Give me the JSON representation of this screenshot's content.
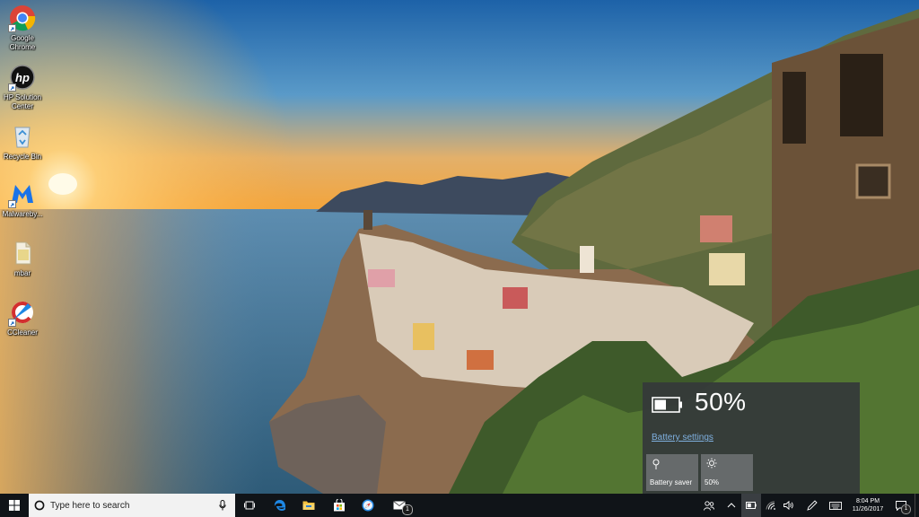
{
  "desktop": {
    "icons": [
      {
        "label": "Google Chrome",
        "icon": "chrome-icon"
      },
      {
        "label": "HP Solution Center",
        "icon": "hp-icon"
      },
      {
        "label": "Recycle Bin",
        "icon": "recycle-bin-icon"
      },
      {
        "label": "Malwareby...",
        "icon": "malwarebytes-icon"
      },
      {
        "label": "mbar",
        "icon": "file-icon"
      },
      {
        "label": "CCleaner",
        "icon": "ccleaner-icon"
      }
    ]
  },
  "battery_flyout": {
    "percent_text": "50%",
    "level": 0.5,
    "settings_link": "Battery settings",
    "tiles": [
      {
        "label": "Battery saver",
        "icon": "battery-saver-icon"
      },
      {
        "label": "50%",
        "icon": "brightness-icon"
      }
    ]
  },
  "taskbar": {
    "search_placeholder": "Type here to search",
    "pinned": [
      "task-view-icon",
      "edge-icon",
      "file-explorer-icon",
      "store-icon",
      "safari-icon",
      "mail-icon"
    ],
    "mail_badge": "1",
    "clock": {
      "time": "8:04 PM",
      "date": "11/26/2017"
    },
    "notification_badge": "1"
  },
  "colors": {
    "taskbar": "#101418",
    "flyout": "#34383a",
    "link": "#7fb0e0",
    "edge_blue": "#1e88e5"
  }
}
